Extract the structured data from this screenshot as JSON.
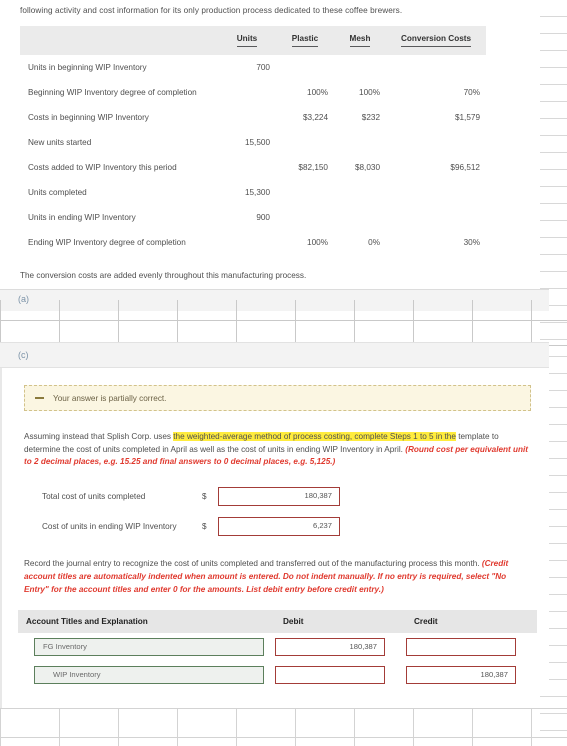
{
  "intro": {
    "paragraph": "following activity and cost information for its only production process dedicated to these coffee brewers."
  },
  "cost_table": {
    "headers": [
      "",
      "Units",
      "Plastic",
      "Mesh",
      "Conversion Costs"
    ],
    "rows": [
      {
        "label": "Units in beginning WIP Inventory",
        "units": "700",
        "plastic": "",
        "mesh": "",
        "conversion": ""
      },
      {
        "label": "Beginning WIP Inventory degree of completion",
        "units": "",
        "plastic": "100%",
        "mesh": "100%",
        "conversion": "70%"
      },
      {
        "label": "Costs in beginning WIP Inventory",
        "units": "",
        "plastic": "$3,224",
        "mesh": "$232",
        "conversion": "$1,579"
      },
      {
        "label": "New units started",
        "units": "15,500",
        "plastic": "",
        "mesh": "",
        "conversion": ""
      },
      {
        "label": "Costs added to WIP Inventory this period",
        "units": "",
        "plastic": "$82,150",
        "mesh": "$8,030",
        "conversion": "$96,512"
      },
      {
        "label": "Units completed",
        "units": "15,300",
        "plastic": "",
        "mesh": "",
        "conversion": ""
      },
      {
        "label": "Units in ending WIP Inventory",
        "units": "900",
        "plastic": "",
        "mesh": "",
        "conversion": ""
      },
      {
        "label": "Ending WIP Inventory degree of completion",
        "units": "",
        "plastic": "100%",
        "mesh": "0%",
        "conversion": "30%"
      }
    ]
  },
  "note": "The conversion costs are added evenly throughout this manufacturing process.",
  "section_a": {
    "label": "(a)"
  },
  "section_c": {
    "label": "(c)",
    "alert": {
      "icon": "minus-icon",
      "message": "Your answer is partially correct."
    },
    "instruction": {
      "part1": "Assuming instead that Splish Corp. uses ",
      "highlight": "the weighted-average method of process costing, complete Steps 1 to 5 in the",
      "part2": " template to determine the cost of units completed in April as well as the cost of units in ending WIP Inventory in April. ",
      "red_note": "(Round cost per equivalent unit to 2 decimal places, e.g. 15.25 and final answers to 0 decimal places, e.g. 5,125.)"
    },
    "answers": {
      "currency_symbol": "$",
      "rows": [
        {
          "label": "Total cost of units completed",
          "value": "180,387"
        },
        {
          "label": "Cost of units in ending WIP Inventory",
          "value": "6,237"
        }
      ]
    },
    "journal_instruction": {
      "black": "Record the journal entry to recognize the cost of units completed and transferred out of the manufacturing process this month.",
      "red": "(Credit account titles are automatically indented when amount is entered. Do not indent manually. If no entry is required, select \"No Entry\" for the account titles and enter 0 for the amounts. List debit entry before credit entry.)"
    },
    "journal_table": {
      "headers": {
        "account": "Account Titles and Explanation",
        "debit": "Debit",
        "credit": "Credit"
      },
      "rows": [
        {
          "account": "FG Inventory",
          "indent": false,
          "debit": "180,387",
          "credit": ""
        },
        {
          "account": "WIP Inventory",
          "indent": true,
          "debit": "",
          "credit": "180,387"
        }
      ]
    }
  },
  "colors": {
    "highlight": "#ffec3d",
    "red_text": "#e03a2f",
    "field_border_red": "#a33c38",
    "field_border_green": "#5c7f5c",
    "section_label": "#7c93a8",
    "alert_bg": "#fbf6e2",
    "alert_border": "#d2c28a",
    "header_bg": "#ebebeb"
  }
}
